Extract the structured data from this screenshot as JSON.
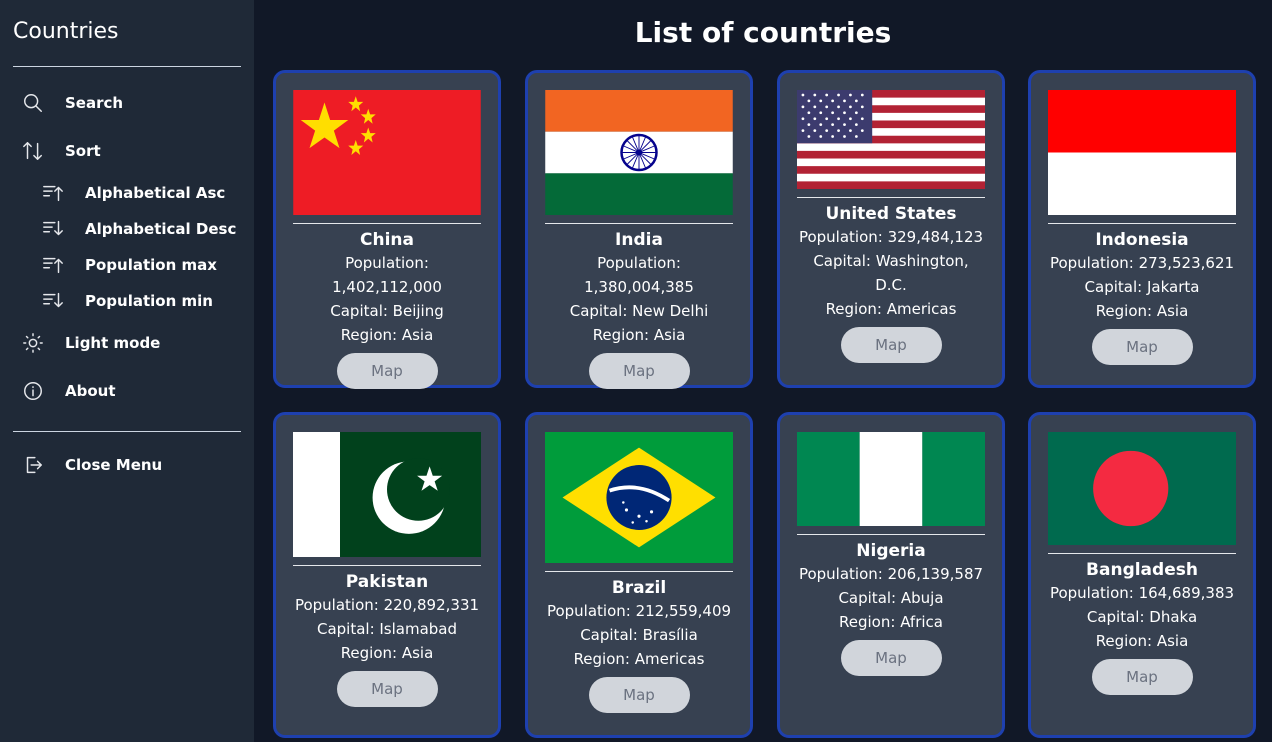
{
  "sidebar": {
    "title": "Countries",
    "search": "Search",
    "sort": "Sort",
    "sort_options": [
      "Alphabetical Asc",
      "Alphabetical Desc",
      "Population max",
      "Population min"
    ],
    "light_mode": "Light mode",
    "about": "About",
    "close_menu": "Close Menu"
  },
  "main": {
    "title": "List of countries",
    "map_label": "Map",
    "countries": [
      {
        "name": "China",
        "population": "Population: 1,402,112,000",
        "capital": "Capital: Beijing",
        "region": "Region: Asia",
        "flag": "china-flag"
      },
      {
        "name": "India",
        "population": "Population: 1,380,004,385",
        "capital": "Capital: New Delhi",
        "region": "Region: Asia",
        "flag": "india-flag"
      },
      {
        "name": "United States",
        "population": "Population: 329,484,123",
        "capital": "Capital: Washington, D.C.",
        "region": "Region: Americas",
        "flag": "usa-flag"
      },
      {
        "name": "Indonesia",
        "population": "Population: 273,523,621",
        "capital": "Capital: Jakarta",
        "region": "Region: Asia",
        "flag": "indonesia-flag"
      },
      {
        "name": "Pakistan",
        "population": "Population: 220,892,331",
        "capital": "Capital: Islamabad",
        "region": "Region: Asia",
        "flag": "pakistan-flag"
      },
      {
        "name": "Brazil",
        "population": "Population: 212,559,409",
        "capital": "Capital: Brasília",
        "region": "Region: Americas",
        "flag": "brazil-flag"
      },
      {
        "name": "Nigeria",
        "population": "Population: 206,139,587",
        "capital": "Capital: Abuja",
        "region": "Region: Africa",
        "flag": "nigeria-flag"
      },
      {
        "name": "Bangladesh",
        "population": "Population: 164,689,383",
        "capital": "Capital: Dhaka",
        "region": "Region: Asia",
        "flag": "bangladesh-flag"
      }
    ]
  },
  "colors": {
    "sidebar_bg": "#1f2937",
    "page_bg": "#111827",
    "card_bg": "#374151",
    "card_border": "#1e40af",
    "map_button_bg": "#d1d5db"
  }
}
